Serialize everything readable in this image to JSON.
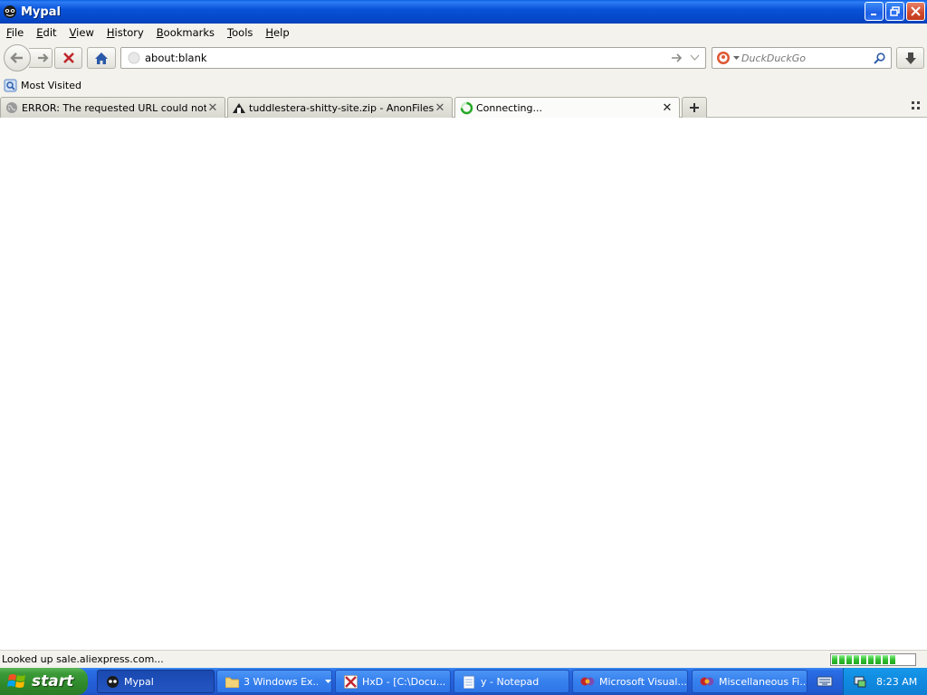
{
  "window": {
    "title": "Mypal"
  },
  "menu": [
    {
      "label": "File",
      "key": "F",
      "rest": "ile"
    },
    {
      "label": "Edit",
      "key": "E",
      "rest": "dit"
    },
    {
      "label": "View",
      "key": "V",
      "rest": "iew"
    },
    {
      "label": "History",
      "key": "H",
      "rest": "istory"
    },
    {
      "label": "Bookmarks",
      "key": "B",
      "rest": "ookmarks"
    },
    {
      "label": "Tools",
      "key": "T",
      "rest": "ools"
    },
    {
      "label": "Help",
      "key": "H",
      "rest": "elp"
    }
  ],
  "navbar": {
    "url": "about:blank",
    "search_placeholder": "DuckDuckGo"
  },
  "bookmarks": [
    {
      "label": "Most Visited"
    }
  ],
  "tabs": [
    {
      "label": "ERROR: The requested URL could not be...",
      "icon": "globe-icon",
      "active": false
    },
    {
      "label": "tuddlestera-shitty-site.zip - AnonFiles",
      "icon": "anonfiles-icon",
      "active": false
    },
    {
      "label": "Connecting...",
      "icon": "loading-spinner-icon",
      "active": true
    }
  ],
  "status": {
    "text": "Looked up sale.aliexpress.com...",
    "progress_segments": 9
  },
  "taskbar": {
    "start_label": "start",
    "tasks": [
      {
        "label": "Mypal",
        "icon": "mypal-icon",
        "active": true
      },
      {
        "label": "3 Windows Ex...",
        "icon": "folder-icon",
        "active": false
      },
      {
        "label": "HxD - [C:\\Docu...",
        "icon": "hxd-icon",
        "active": false
      },
      {
        "label": "y - Notepad",
        "icon": "notepad-icon",
        "active": false
      },
      {
        "label": "Microsoft Visual...",
        "icon": "visual-studio-icon",
        "active": false
      },
      {
        "label": "Miscellaneous Fi...",
        "icon": "visual-studio-icon",
        "active": false
      }
    ],
    "clock": "8:23 AM"
  },
  "colors": {
    "titlebar": "#0546c6",
    "taskbar": "#2560d8",
    "start": "#2f8a2b",
    "chrome": "#f3f2ec"
  }
}
